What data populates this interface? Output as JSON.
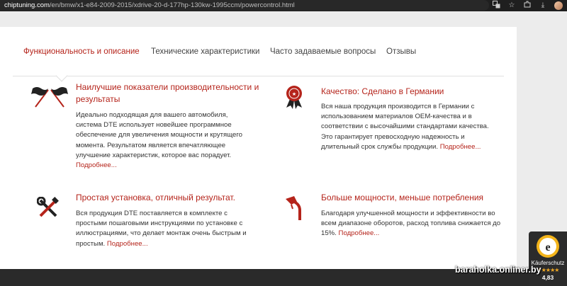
{
  "browser": {
    "url_domain": "chiptuning.com",
    "url_path": "/en/bmw/x1-e84-2009-2015/xdrive-20-d-177hp-130kw-1995ccm/powercontrol.html",
    "icons": [
      "translate-icon",
      "star-icon",
      "extensions-icon",
      "download-icon",
      "profile-avatar"
    ]
  },
  "tabs": [
    {
      "label": "Функциональность и описание",
      "active": true
    },
    {
      "label": "Технические характеристики",
      "active": false
    },
    {
      "label": "Часто задаваемые вопросы",
      "active": false
    },
    {
      "label": "Отзывы",
      "active": false
    }
  ],
  "features": [
    {
      "icon": "racing-flags-icon",
      "title": "Наилучшие показатели производительности и результаты",
      "text": "Идеально подходящая для вашего автомобиля, система DTE использует новейшее программное обеспечение для увеличения мощности и крутящего момента. Результатом является впечатляющее улучшение характеристик, которое вас порадует.",
      "link": "Подробнее..."
    },
    {
      "icon": "quality-seal-icon",
      "title": "Качество: Сделано в Германии",
      "text": "Вся наша продукция производится в Германии с использованием материалов OEM-качества и в соответствии с высочайшими стандартами качества. Это гарантирует превосходную надежность и длительный срок службы продукции.",
      "link": "Подробнее..."
    },
    {
      "icon": "wrench-screwdriver-icon",
      "title": "Простая установка, отличный результат.",
      "text": "Вся продукция DTE поставляется в комплекте с простыми пошаговыми инструкциями по установке с иллюстрациями, что делает монтаж очень быстрым и простым.",
      "link": "Подробнее..."
    },
    {
      "icon": "fuel-nozzle-icon",
      "title": "Больше мощности, меньше потребления",
      "text": "Благодаря улучшенной мощности и эффективности во всем диапазоне оборотов, расход топлива снижается до 15%.",
      "link": "Подробнее..."
    }
  ],
  "badge": {
    "label": "Käuferschutz",
    "stars": "★★★★★",
    "score": "4,83"
  },
  "watermark": "baraholka.onliner.by",
  "colors": {
    "accent": "#b5241b",
    "page_bg": "#ececec",
    "card_bg": "#ffffff"
  }
}
